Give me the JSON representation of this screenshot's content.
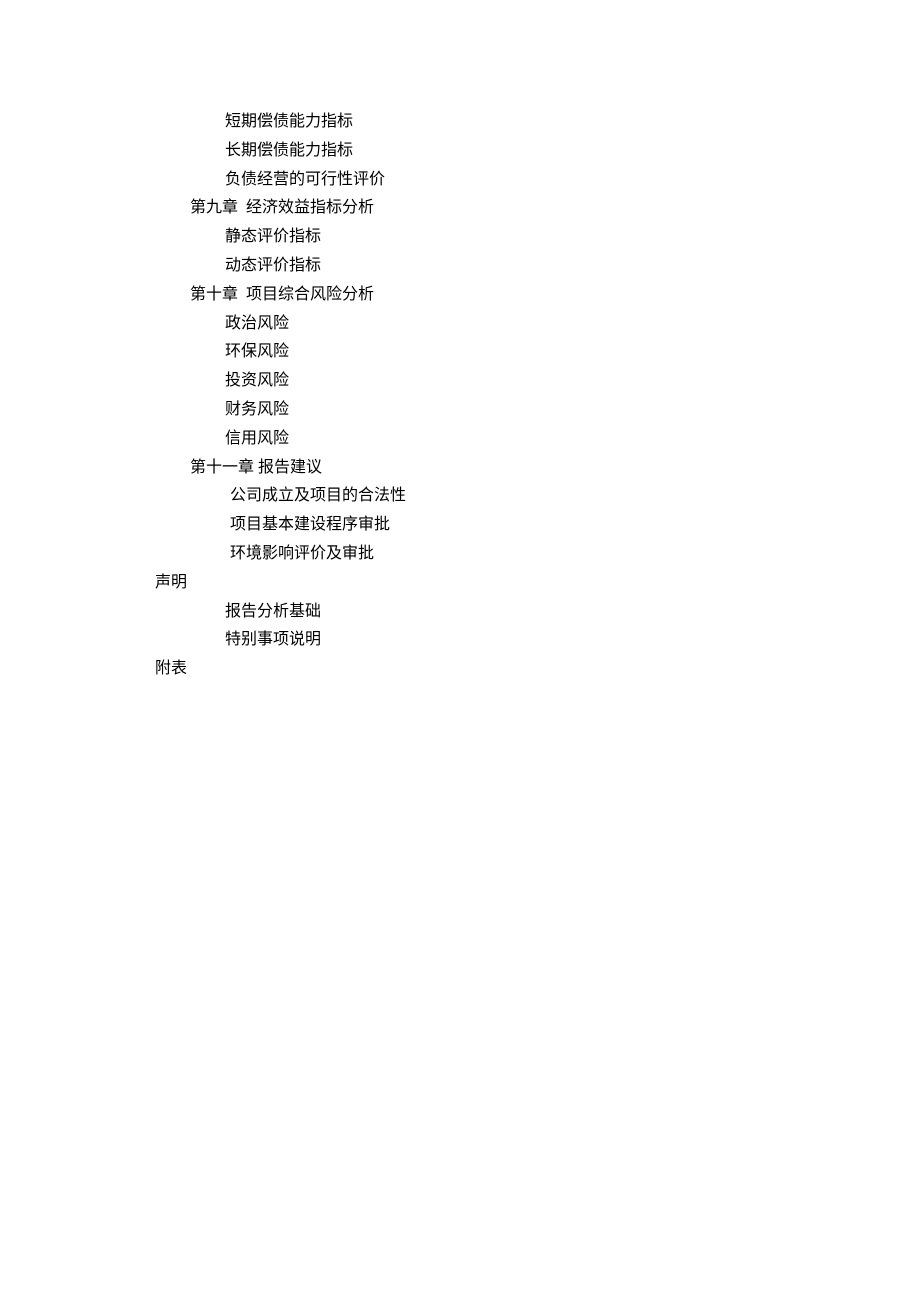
{
  "toc": {
    "items": [
      {
        "level": 2,
        "text": "短期偿债能力指标"
      },
      {
        "level": 2,
        "text": "长期偿债能力指标"
      },
      {
        "level": 2,
        "text": "负债经营的可行性评价"
      },
      {
        "level": 1,
        "text": "第九章  经济效益指标分析"
      },
      {
        "level": 2,
        "text": "静态评价指标"
      },
      {
        "level": 2,
        "text": "动态评价指标"
      },
      {
        "level": 1,
        "text": "第十章  项目综合风险分析"
      },
      {
        "level": 2,
        "text": "政治风险"
      },
      {
        "level": 2,
        "text": "环保风险"
      },
      {
        "level": 2,
        "text": "投资风险"
      },
      {
        "level": 2,
        "text": "财务风险"
      },
      {
        "level": 2,
        "text": "信用风险"
      },
      {
        "level": 1,
        "text": "第十一章 报告建议"
      },
      {
        "level": 3,
        "text": "公司成立及项目的合法性"
      },
      {
        "level": 3,
        "text": "项目基本建设程序审批"
      },
      {
        "level": 3,
        "text": "环境影响评价及审批"
      },
      {
        "level": 0,
        "text": "声明"
      },
      {
        "level": 2,
        "text": "报告分析基础"
      },
      {
        "level": 2,
        "text": "特别事项说明"
      },
      {
        "level": 0,
        "text": "附表"
      }
    ]
  }
}
